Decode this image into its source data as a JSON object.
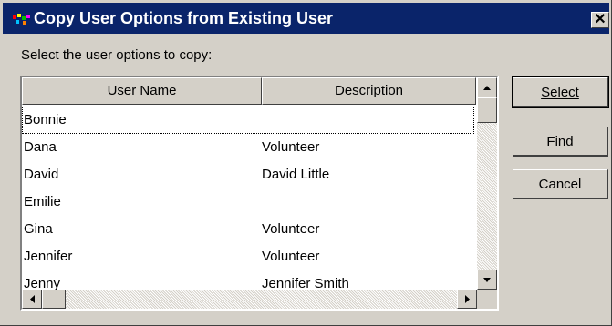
{
  "dialog": {
    "title": "Copy User Options from Existing User",
    "close_glyph": "✕",
    "instruction": "Select the user options to copy:"
  },
  "table": {
    "columns": [
      "User Name",
      "Description"
    ],
    "rows": [
      {
        "name": "Bonnie",
        "description": ""
      },
      {
        "name": "Dana",
        "description": "Volunteer"
      },
      {
        "name": "David",
        "description": "David Little"
      },
      {
        "name": "Emilie",
        "description": ""
      },
      {
        "name": "Gina",
        "description": "Volunteer"
      },
      {
        "name": "Jennifer",
        "description": "Volunteer"
      },
      {
        "name": "Jenny",
        "description": "Jennifer Smith"
      }
    ]
  },
  "buttons": {
    "select_label": "Select",
    "find_label": "Find",
    "cancel_label": "Cancel"
  },
  "icons": {
    "app": "app-icon",
    "close": "close-icon",
    "scroll_up": "arrow-up-icon",
    "scroll_down": "arrow-down-icon",
    "scroll_left": "arrow-left-icon",
    "scroll_right": "arrow-right-icon"
  },
  "colors": {
    "titlebar": "#0a246a",
    "face": "#d4d0c8"
  }
}
